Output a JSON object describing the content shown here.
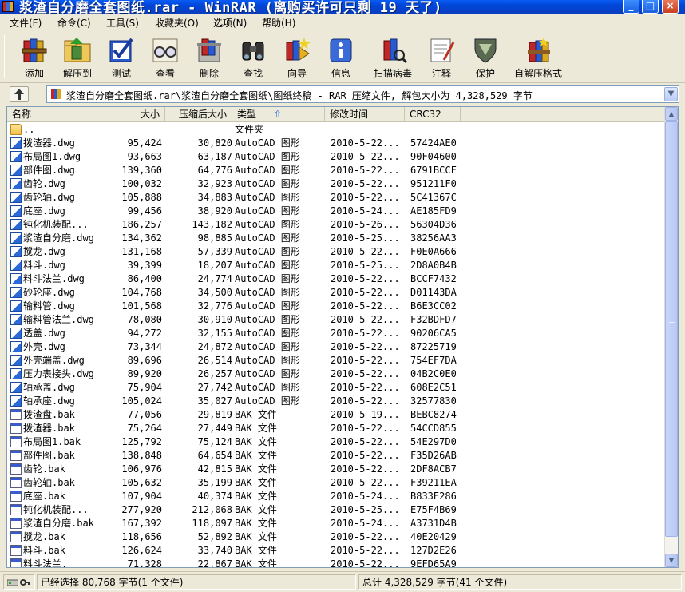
{
  "window": {
    "title": "浆渣自分磨全套图纸.rar - WinRAR (离购买许可只剩 19 天了)",
    "min_glyph": "_",
    "max_glyph": "□",
    "close_glyph": "×"
  },
  "menu": [
    "文件(F)",
    "命令(C)",
    "工具(S)",
    "收藏夹(O)",
    "选项(N)",
    "帮助(H)"
  ],
  "toolbar": [
    {
      "label": "添加",
      "icon": "add-books-icon"
    },
    {
      "label": "解压到",
      "icon": "extract-folder-icon"
    },
    {
      "label": "测试",
      "icon": "test-check-icon"
    },
    {
      "label": "查看",
      "icon": "view-glasses-icon"
    },
    {
      "label": "删除",
      "icon": "delete-trash-icon"
    },
    {
      "label": "查找",
      "icon": "find-binoculars-icon"
    },
    {
      "label": "向导",
      "icon": "wizard-icon"
    },
    {
      "label": "信息",
      "icon": "info-icon"
    },
    {
      "label": "扫描病毒",
      "icon": "virus-scan-icon"
    },
    {
      "label": "注释",
      "icon": "comment-icon"
    },
    {
      "label": "保护",
      "icon": "protect-shield-icon"
    },
    {
      "label": "自解压格式",
      "icon": "sfx-icon"
    }
  ],
  "address": {
    "path": "浆渣自分磨全套图纸.rar\\浆渣自分磨全套图纸\\图纸终稿 - RAR 压缩文件, 解包大小为 4,328,529 字节",
    "dropdown_glyph": "▼"
  },
  "columns": {
    "name": "名称",
    "size": "大小",
    "packed": "压缩后大小",
    "type": "类型",
    "sort_glyph": "⇧",
    "modified": "修改时间",
    "crc": "CRC32"
  },
  "files": [
    {
      "icon": "folder",
      "name": "..",
      "size": "",
      "packed": "",
      "type": "文件夹",
      "modified": "",
      "crc": ""
    },
    {
      "icon": "dwg",
      "name": "拨渣器.dwg",
      "size": "95,424",
      "packed": "30,820",
      "type": "AutoCAD 图形",
      "modified": "2010-5-22...",
      "crc": "57424AE0"
    },
    {
      "icon": "dwg",
      "name": "布局图1.dwg",
      "size": "93,663",
      "packed": "63,187",
      "type": "AutoCAD 图形",
      "modified": "2010-5-22...",
      "crc": "90F04600"
    },
    {
      "icon": "dwg",
      "name": "部件图.dwg",
      "size": "139,360",
      "packed": "64,776",
      "type": "AutoCAD 图形",
      "modified": "2010-5-22...",
      "crc": "6791BCCF"
    },
    {
      "icon": "dwg",
      "name": "齿轮.dwg",
      "size": "100,032",
      "packed": "32,923",
      "type": "AutoCAD 图形",
      "modified": "2010-5-22...",
      "crc": "951211F0"
    },
    {
      "icon": "dwg",
      "name": "齿轮轴.dwg",
      "size": "105,888",
      "packed": "34,883",
      "type": "AutoCAD 图形",
      "modified": "2010-5-22...",
      "crc": "5C41367C"
    },
    {
      "icon": "dwg",
      "name": "底座.dwg",
      "size": "99,456",
      "packed": "38,920",
      "type": "AutoCAD 图形",
      "modified": "2010-5-24...",
      "crc": "AE185FD9"
    },
    {
      "icon": "dwg",
      "name": "钝化机装配...",
      "size": "186,257",
      "packed": "143,182",
      "type": "AutoCAD 图形",
      "modified": "2010-5-26...",
      "crc": "56304D36"
    },
    {
      "icon": "dwg",
      "name": "浆渣自分磨.dwg",
      "size": "134,362",
      "packed": "98,885",
      "type": "AutoCAD 图形",
      "modified": "2010-5-25...",
      "crc": "38256AA3"
    },
    {
      "icon": "dwg",
      "name": "搅龙.dwg",
      "size": "131,168",
      "packed": "57,339",
      "type": "AutoCAD 图形",
      "modified": "2010-5-22...",
      "crc": "F0E0A666"
    },
    {
      "icon": "dwg",
      "name": "料斗.dwg",
      "size": "39,399",
      "packed": "18,207",
      "type": "AutoCAD 图形",
      "modified": "2010-5-25...",
      "crc": "2D8A0B4B"
    },
    {
      "icon": "dwg",
      "name": "料斗法兰.dwg",
      "size": "86,400",
      "packed": "24,774",
      "type": "AutoCAD 图形",
      "modified": "2010-5-22...",
      "crc": "BCCF7432"
    },
    {
      "icon": "dwg",
      "name": "砂轮座.dwg",
      "size": "104,768",
      "packed": "34,500",
      "type": "AutoCAD 图形",
      "modified": "2010-5-22...",
      "crc": "D01143DA"
    },
    {
      "icon": "dwg",
      "name": "输料管.dwg",
      "size": "101,568",
      "packed": "32,776",
      "type": "AutoCAD 图形",
      "modified": "2010-5-22...",
      "crc": "B6E3CC02"
    },
    {
      "icon": "dwg",
      "name": "输料管法兰.dwg",
      "size": "78,080",
      "packed": "30,910",
      "type": "AutoCAD 图形",
      "modified": "2010-5-22...",
      "crc": "F32BDFD7"
    },
    {
      "icon": "dwg",
      "name": "透盖.dwg",
      "size": "94,272",
      "packed": "32,155",
      "type": "AutoCAD 图形",
      "modified": "2010-5-22...",
      "crc": "90206CA5"
    },
    {
      "icon": "dwg",
      "name": "外壳.dwg",
      "size": "73,344",
      "packed": "24,872",
      "type": "AutoCAD 图形",
      "modified": "2010-5-22...",
      "crc": "87225719"
    },
    {
      "icon": "dwg",
      "name": "外壳端盖.dwg",
      "size": "89,696",
      "packed": "26,514",
      "type": "AutoCAD 图形",
      "modified": "2010-5-22...",
      "crc": "754EF7DA"
    },
    {
      "icon": "dwg",
      "name": "压力表接头.dwg",
      "size": "89,920",
      "packed": "26,257",
      "type": "AutoCAD 图形",
      "modified": "2010-5-22...",
      "crc": "04B2C0E0"
    },
    {
      "icon": "dwg",
      "name": "轴承盖.dwg",
      "size": "75,904",
      "packed": "27,742",
      "type": "AutoCAD 图形",
      "modified": "2010-5-22...",
      "crc": "608E2C51"
    },
    {
      "icon": "dwg",
      "name": "轴承座.dwg",
      "size": "105,024",
      "packed": "35,027",
      "type": "AutoCAD 图形",
      "modified": "2010-5-22...",
      "crc": "32577830"
    },
    {
      "icon": "bak",
      "name": "拨渣盘.bak",
      "size": "77,056",
      "packed": "29,819",
      "type": "BAK 文件",
      "modified": "2010-5-19...",
      "crc": "BEBC8274"
    },
    {
      "icon": "bak",
      "name": "拨渣器.bak",
      "size": "75,264",
      "packed": "27,449",
      "type": "BAK 文件",
      "modified": "2010-5-22...",
      "crc": "54CCD855"
    },
    {
      "icon": "bak",
      "name": "布局图1.bak",
      "size": "125,792",
      "packed": "75,124",
      "type": "BAK 文件",
      "modified": "2010-5-22...",
      "crc": "54E297D0"
    },
    {
      "icon": "bak",
      "name": "部件图.bak",
      "size": "138,848",
      "packed": "64,654",
      "type": "BAK 文件",
      "modified": "2010-5-22...",
      "crc": "F35D26AB"
    },
    {
      "icon": "bak",
      "name": "齿轮.bak",
      "size": "106,976",
      "packed": "42,815",
      "type": "BAK 文件",
      "modified": "2010-5-22...",
      "crc": "2DF8ACB7"
    },
    {
      "icon": "bak",
      "name": "齿轮轴.bak",
      "size": "105,632",
      "packed": "35,199",
      "type": "BAK 文件",
      "modified": "2010-5-22...",
      "crc": "F39211EA"
    },
    {
      "icon": "bak",
      "name": "底座.bak",
      "size": "107,904",
      "packed": "40,374",
      "type": "BAK 文件",
      "modified": "2010-5-24...",
      "crc": "B833E286"
    },
    {
      "icon": "bak",
      "name": "钝化机装配...",
      "size": "277,920",
      "packed": "212,068",
      "type": "BAK 文件",
      "modified": "2010-5-25...",
      "crc": "E75F4B69"
    },
    {
      "icon": "bak",
      "name": "浆渣自分磨.bak",
      "size": "167,392",
      "packed": "118,097",
      "type": "BAK 文件",
      "modified": "2010-5-24...",
      "crc": "A3731D4B"
    },
    {
      "icon": "bak",
      "name": "搅龙.bak",
      "size": "118,656",
      "packed": "52,892",
      "type": "BAK 文件",
      "modified": "2010-5-22...",
      "crc": "40E20429"
    },
    {
      "icon": "bak",
      "name": "料斗.bak",
      "size": "126,624",
      "packed": "33,740",
      "type": "BAK 文件",
      "modified": "2010-5-22...",
      "crc": "127D2E26"
    },
    {
      "icon": "bak",
      "name": "料斗法兰.",
      "size": "71,328",
      "packed": "22,867",
      "type": "BAK 文件",
      "modified": "2010-5-22...",
      "crc": "9EFD65A9"
    }
  ],
  "status": {
    "left": "已经选择 80,768 字节(1 个文件)",
    "right": "总计 4,328,529 字节(41 个文件)"
  }
}
